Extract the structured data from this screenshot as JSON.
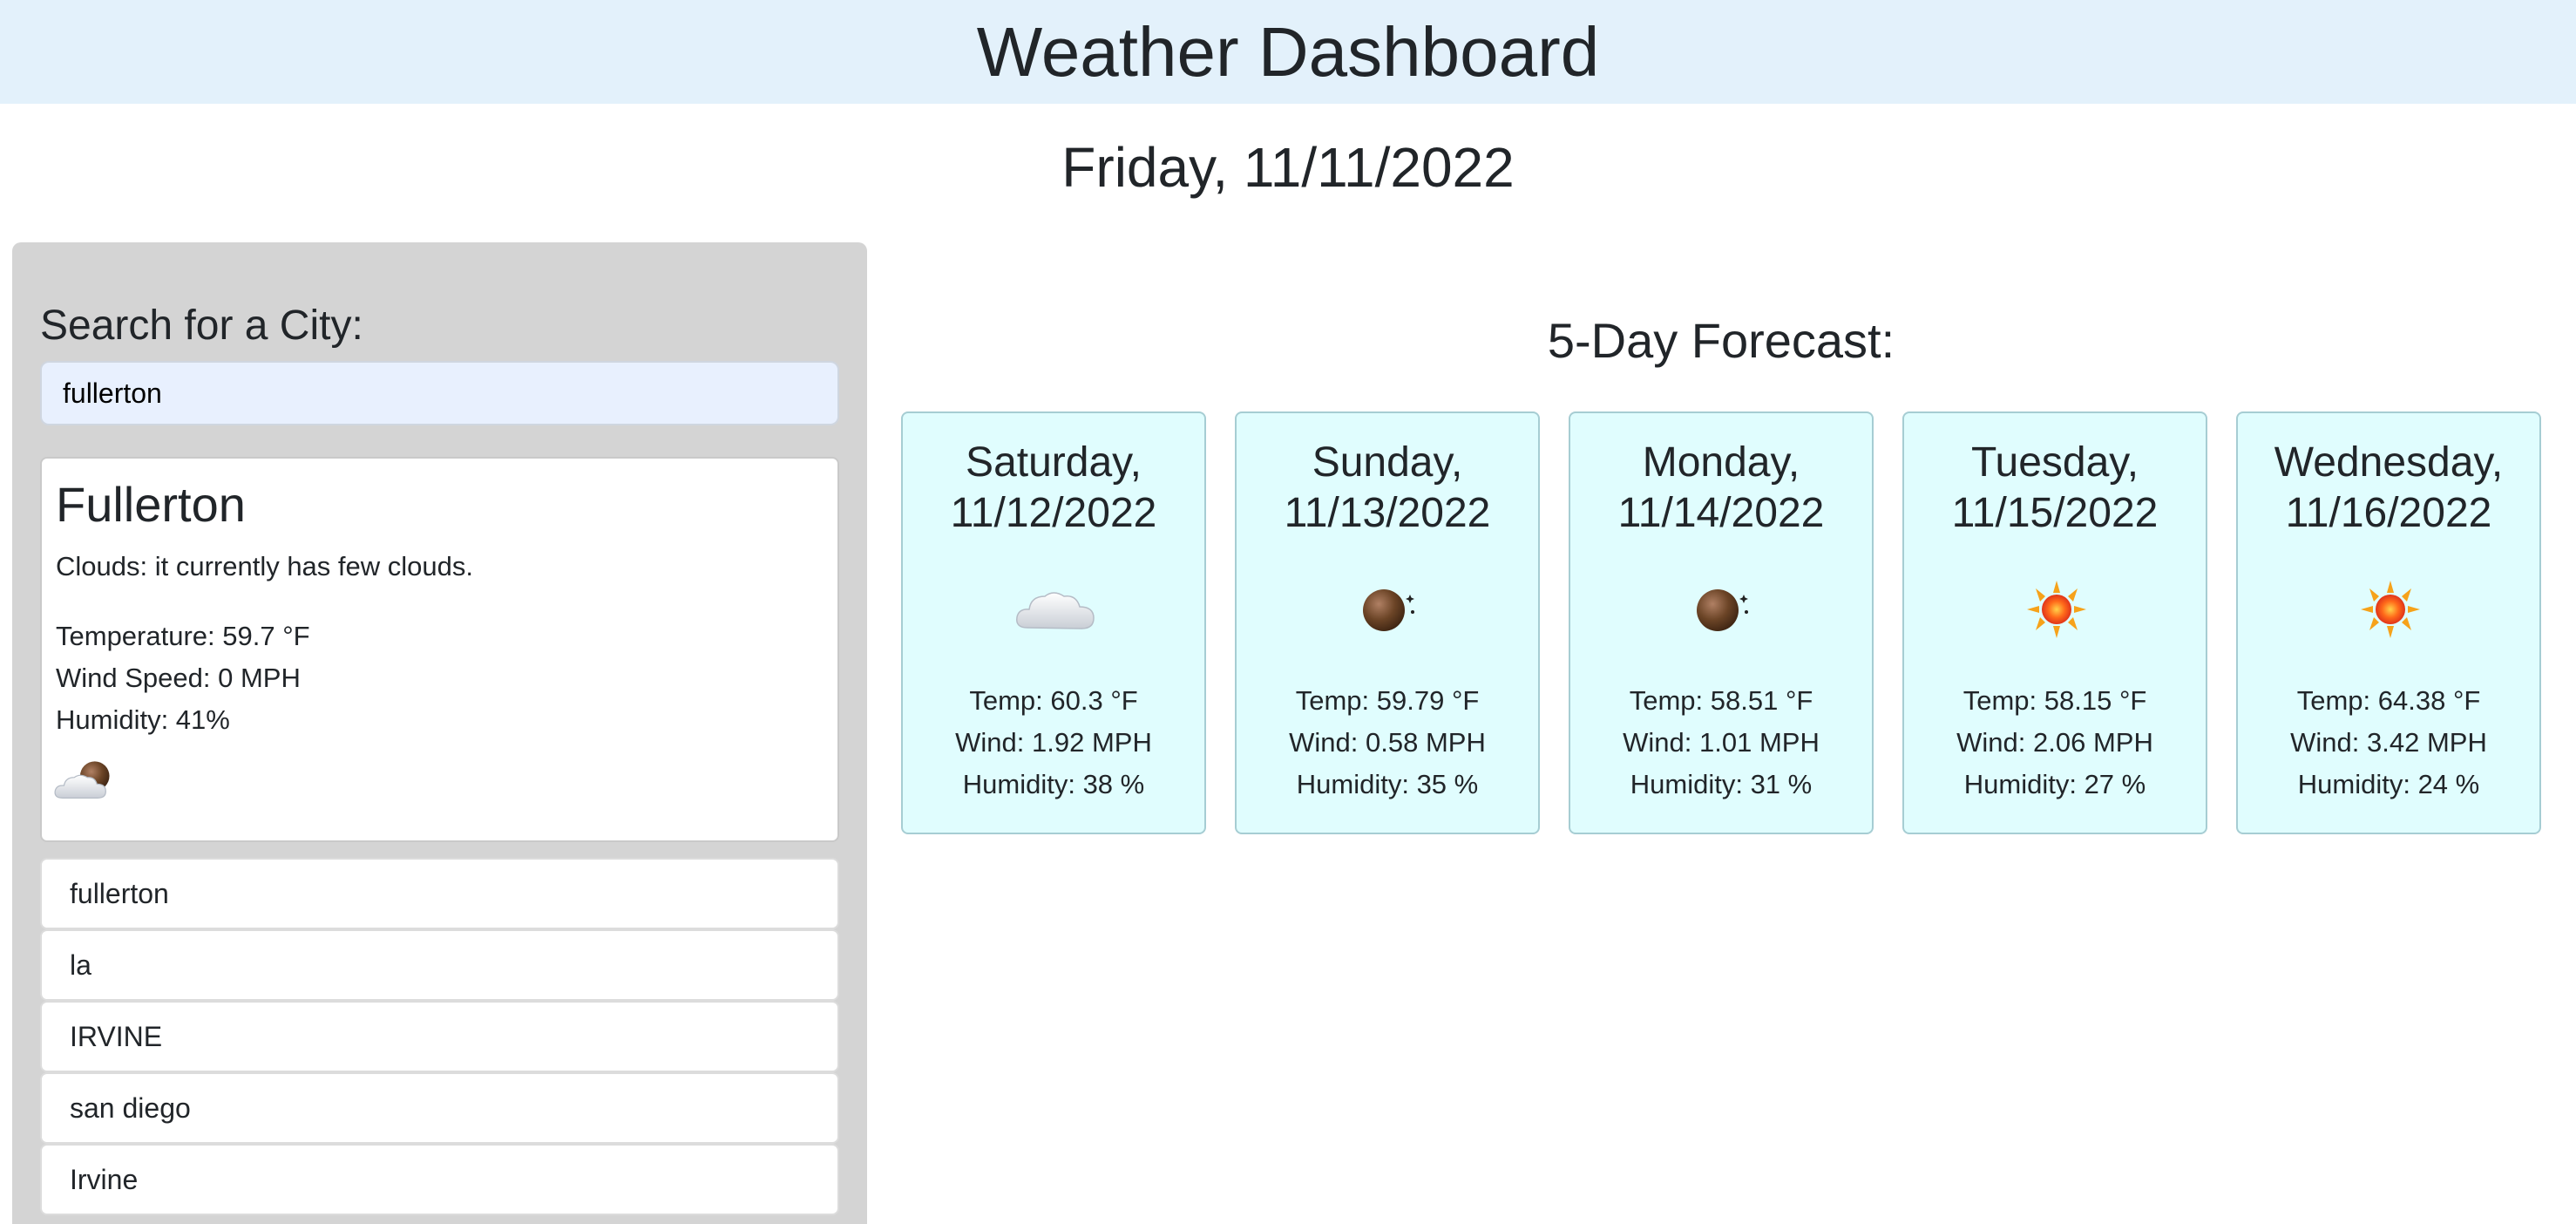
{
  "header": {
    "title": "Weather Dashboard"
  },
  "today": {
    "date": "Friday, 11/11/2022"
  },
  "sidebar": {
    "title": "Search for a City:",
    "search_value": "fullerton",
    "current": {
      "city": "Fullerton",
      "description": "Clouds: it currently has few clouds.",
      "temperature": "Temperature: 59.7 °F",
      "wind": "Wind Speed: 0 MPH",
      "humidity": "Humidity: 41%",
      "icon": "partly-cloudy-night-icon"
    },
    "history": [
      "fullerton",
      "la",
      "IRVINE",
      "san diego",
      "Irvine"
    ]
  },
  "forecast": {
    "title": "5-Day Forecast:",
    "days": [
      {
        "day": "Saturday,",
        "date": "11/12/2022",
        "icon": "cloud-icon",
        "temp": "Temp: 60.3 °F",
        "wind": "Wind: 1.92 MPH",
        "humidity": "Humidity: 38 %"
      },
      {
        "day": "Sunday,",
        "date": "11/13/2022",
        "icon": "moon-icon",
        "temp": "Temp: 59.79 °F",
        "wind": "Wind: 0.58 MPH",
        "humidity": "Humidity: 35 %"
      },
      {
        "day": "Monday,",
        "date": "11/14/2022",
        "icon": "moon-icon",
        "temp": "Temp: 58.51 °F",
        "wind": "Wind: 1.01 MPH",
        "humidity": "Humidity: 31 %"
      },
      {
        "day": "Tuesday,",
        "date": "11/15/2022",
        "icon": "sun-icon",
        "temp": "Temp: 58.15 °F",
        "wind": "Wind: 2.06 MPH",
        "humidity": "Humidity: 27 %"
      },
      {
        "day": "Wednesday,",
        "date": "11/16/2022",
        "icon": "sun-icon",
        "temp": "Temp: 64.38 °F",
        "wind": "Wind: 3.42 MPH",
        "humidity": "Humidity: 24 %"
      }
    ]
  },
  "colors": {
    "header_bg": "#e3f1fb",
    "sidebar_bg": "#d4d4d4",
    "card_bg": "#e0fdfe",
    "input_bg": "#e8f0fe"
  }
}
